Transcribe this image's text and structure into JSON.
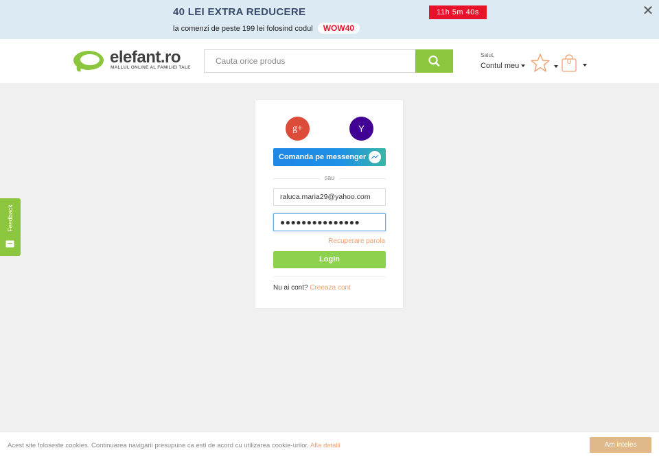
{
  "promo": {
    "title": "40 LEI EXTRA REDUCERE",
    "subtitle": "la comenzi de peste 199 lei folosind codul",
    "code": "WOW40",
    "timer": "11h 5m 40s",
    "close": "✕"
  },
  "header": {
    "logo_text": "elefant.ro",
    "logo_tagline": "MALLUL ONLINE AL FAMILIEI TALE",
    "search_placeholder": "Cauta orice produs",
    "account_greeting": "Salut,",
    "account_label": "Contul meu",
    "cart_count": "0"
  },
  "login": {
    "google_label": "g+",
    "yahoo_label": "Y",
    "messenger_label": "Comanda pe messenger",
    "or_label": "sau",
    "email_value": "raluca.maria29@yahoo.com",
    "password_value": "●●●●●●●●●●●●●●●",
    "recover_label": "Recuperare parola",
    "login_label": "Login",
    "no_account_text": "Nu ai cont?",
    "create_account_label": "Creeaza cont"
  },
  "feedback": {
    "label": "Feedback"
  },
  "cookie": {
    "text": "Acest site foloseste cookies. Continuarea navigarii presupune ca esti de acord cu utilizarea cookie-urilor.",
    "details_link": "Afla detalii",
    "accept_label": "Am inteles"
  },
  "colors": {
    "brand_green": "#8cc63f",
    "accent_orange": "#f0a070",
    "timer_red": "#e8132a",
    "google_red": "#dd4b39",
    "yahoo_purple": "#410093",
    "messenger_blue": "#1e88e5"
  }
}
